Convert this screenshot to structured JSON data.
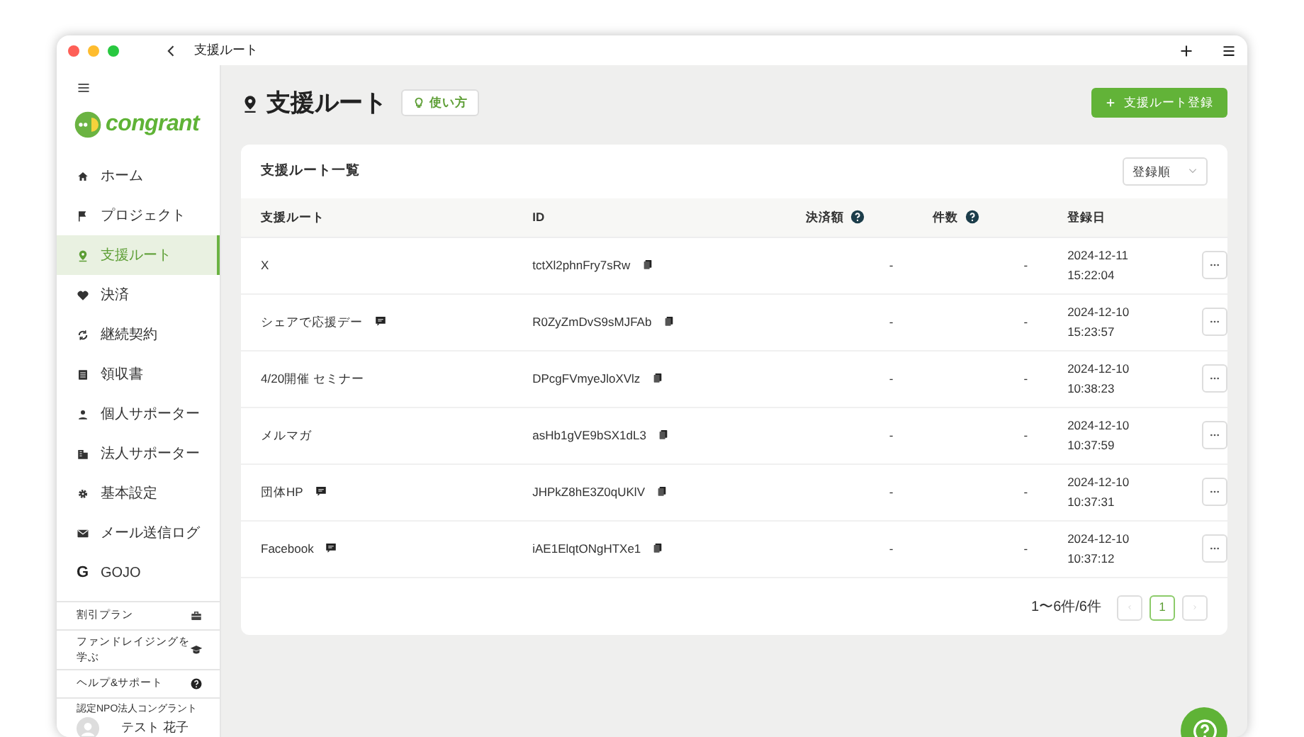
{
  "window": {
    "title": "支援ルート"
  },
  "sidebar": {
    "logo_text": "congrant",
    "items": [
      {
        "label": "ホーム",
        "selected": false
      },
      {
        "label": "プロジェクト",
        "selected": false
      },
      {
        "label": "支援ルート",
        "selected": true
      },
      {
        "label": "決済",
        "selected": false
      },
      {
        "label": "継続契約",
        "selected": false
      },
      {
        "label": "領収書",
        "selected": false
      },
      {
        "label": "個人サポーター",
        "selected": false
      },
      {
        "label": "法人サポーター",
        "selected": false
      },
      {
        "label": "基本設定",
        "selected": false
      },
      {
        "label": "メール送信ログ",
        "selected": false
      },
      {
        "label": "GOJO",
        "selected": false,
        "glyph": "G"
      }
    ],
    "links": [
      {
        "label": "割引プラン"
      },
      {
        "label": "ファンドレイジングを学ぶ"
      },
      {
        "label": "ヘルプ&サポート"
      }
    ],
    "org_name": "認定NPO法人コングラント",
    "user_name": "テスト 花子"
  },
  "page": {
    "title": "支援ルート",
    "help_button": "使い方",
    "add_button": "支援ルート登録"
  },
  "list": {
    "title": "支援ルート一覧",
    "sort": "登録順",
    "columns": [
      {
        "label": "支援ルート",
        "help": false
      },
      {
        "label": "ID",
        "help": false
      },
      {
        "label": "決済額",
        "help": true
      },
      {
        "label": "件数",
        "help": true
      },
      {
        "label": "登録日",
        "help": false
      }
    ],
    "rows": [
      {
        "name": "X",
        "memo": false,
        "id": "tctXl2phnFry7sRw",
        "amount": "-",
        "count": "-",
        "date": "2024-12-11",
        "time": "15:22:04"
      },
      {
        "name": "シェアで応援デー",
        "memo": true,
        "id": "R0ZyZmDvS9sMJFAb",
        "amount": "-",
        "count": "-",
        "date": "2024-12-10",
        "time": "15:23:57"
      },
      {
        "name": "4/20開催 セミナー",
        "memo": false,
        "id": "DPcgFVmyeJloXVlz",
        "amount": "-",
        "count": "-",
        "date": "2024-12-10",
        "time": "10:38:23"
      },
      {
        "name": "メルマガ",
        "memo": false,
        "id": "asHb1gVE9bSX1dL3",
        "amount": "-",
        "count": "-",
        "date": "2024-12-10",
        "time": "10:37:59"
      },
      {
        "name": "団体HP",
        "memo": true,
        "id": "JHPkZ8hE3Z0qUKlV",
        "amount": "-",
        "count": "-",
        "date": "2024-12-10",
        "time": "10:37:31"
      },
      {
        "name": "Facebook",
        "memo": true,
        "id": "iAE1ElqtONgHTXe1",
        "amount": "-",
        "count": "-",
        "date": "2024-12-10",
        "time": "10:37:12"
      }
    ],
    "pagination": {
      "summary": "1〜6件/6件",
      "pages": [
        {
          "label": "1",
          "selected": true
        }
      ]
    }
  }
}
